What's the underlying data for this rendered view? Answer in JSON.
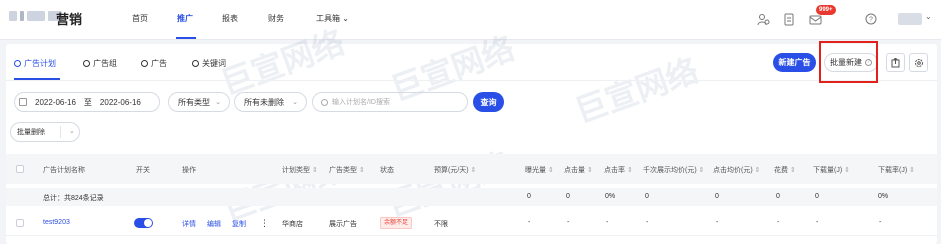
{
  "topbar": {
    "logo_text": "营销",
    "nav": [
      "首页",
      "推广",
      "报表",
      "财务",
      "工具箱"
    ],
    "nav_active_index": 1,
    "tools_caret": "⌄",
    "badge": "999+"
  },
  "tabs": [
    {
      "label": "广告计划",
      "active": true
    },
    {
      "label": "广告组",
      "active": false
    },
    {
      "label": "广告",
      "active": false
    },
    {
      "label": "关键词",
      "active": false
    }
  ],
  "actions": {
    "new_ad": "新建广告",
    "bulk_new": "批量新建"
  },
  "filters": {
    "date_start": "2022-06-16",
    "date_to": "至",
    "date_end": "2022-06-16",
    "type_select": "所有类型",
    "deleted_select": "所有未删除",
    "search_placeholder": "输入计划名/ID搜索",
    "query_button": "查询"
  },
  "bulk_delete": "批量删除",
  "table": {
    "headers": {
      "name": "广告计划名称",
      "switch": "开关",
      "ops": "操作",
      "plan_type": "计划类型",
      "ad_type": "广告类型",
      "status": "状态",
      "budget": "预算(元/天)",
      "impressions": "曝光量",
      "clicks": "点击量",
      "ctr": "点击率",
      "cpm": "千次展示均价(元)",
      "cpc": "点击均价(元)",
      "cost": "花费",
      "downloads": "下载量(J)",
      "download_rate": "下载率(J)"
    },
    "total": {
      "label": "总计：共824条记录",
      "impressions": "0",
      "clicks": "0",
      "ctr": "0%",
      "cpm": "0",
      "cpc": "0",
      "cost": "0",
      "downloads": "0",
      "download_rate": "0%"
    },
    "rows": [
      {
        "name": "test9203",
        "switch_on": true,
        "ops": [
          "详情",
          "编辑",
          "复制"
        ],
        "more": "⋮",
        "plan_type": "华商店",
        "ad_type": "展示广告",
        "status": "余额不足",
        "budget": "不限",
        "impressions": "-",
        "clicks": "-",
        "ctr": "-",
        "cpm": "-",
        "cpc": "-",
        "cost": "-",
        "downloads": "-",
        "download_rate": "-"
      }
    ]
  },
  "watermark": "巨宣网络",
  "colors": {
    "primary": "#2a4fe6",
    "highlight_box": "#e3211c",
    "status_red": "#e3443b"
  }
}
